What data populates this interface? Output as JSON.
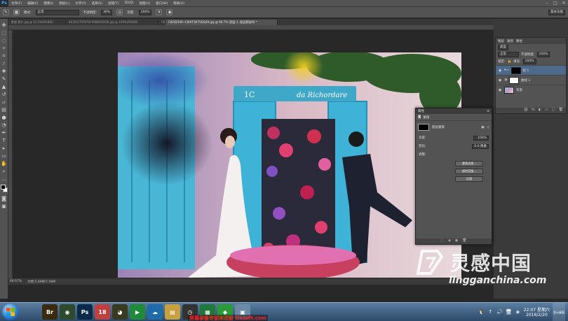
{
  "app": {
    "logo": "Ps"
  },
  "menus": [
    "文件(F)",
    "编辑(E)",
    "图像(I)",
    "图层(L)",
    "文字(Y)",
    "选择(S)",
    "滤镜(T)",
    "3D(D)",
    "视图(V)",
    "窗口(W)",
    "帮助(H)"
  ],
  "window_buttons": [
    "–",
    "□",
    "✕"
  ],
  "options": {
    "mode_label": "模式:",
    "mode_value": "正常",
    "opacity_label": "不透明度:",
    "opacity_value": "30%",
    "flow_label": "流量:",
    "flow_value": "100%",
    "workspace": "基本功能"
  },
  "tabs": [
    {
      "label": "影楼-照片.jpg @ 12.5%(RGB/8)",
      "active": false
    },
    {
      "label": "4E3D17F0F0F0F59BB4ADQR.jpg @ 100%(RGB/8)",
      "active": false
    },
    {
      "label": "C8ZQ2HW...@ 100%(RGB/8)",
      "active": false
    },
    {
      "label": "C82QZHI4~C0HIT.947SQQ49.jpg @ 66.7% (图层 1, 图层蒙版/8) *",
      "active": true
    }
  ],
  "status": {
    "zoom": "66.67%",
    "doc": "文档:5.69M/7.59M"
  },
  "layers": {
    "tabs": [
      "图层",
      "通道",
      "路径"
    ],
    "kind_label": "类型",
    "blend": "正常",
    "opacity_label": "不透明度:",
    "opacity_value": "100%",
    "lock_label": "锁定:",
    "fill_label": "填充:",
    "fill_value": "100%",
    "items": [
      {
        "name": "组 1",
        "thumb": "black",
        "selected": true
      },
      {
        "name": "曲线 1",
        "thumb": "white",
        "selected": false
      },
      {
        "name": "背景",
        "thumb": "photo",
        "selected": false
      }
    ],
    "footer_icons": [
      "⛓",
      "fx",
      "◐",
      "▭",
      "▢",
      "🗑"
    ]
  },
  "properties": {
    "header": "属性",
    "title": "蒙版",
    "mask_label": "图层蒙版",
    "density_label": "浓度:",
    "density_value": "100%",
    "feather_label": "羽化:",
    "feather_value": "0.0 像素",
    "adjust_label": "调整:",
    "btn_edge": "蒙版边缘...",
    "btn_color": "颜色范围...",
    "btn_invert": "反相"
  },
  "watermark": {
    "cn": "灵感中国",
    "url": "lingganchina.com"
  },
  "taskbar": {
    "apps": [
      {
        "name": "bridge-app",
        "label": "Br",
        "color": "#3a2a10"
      },
      {
        "name": "eye-app",
        "label": "◉",
        "color": "#2d4a2d"
      },
      {
        "name": "photoshop-app",
        "label": "Ps",
        "color": "#0a2a4a"
      },
      {
        "name": "calendar-app",
        "label": "18",
        "color": "#c04040"
      },
      {
        "name": "qq-app",
        "label": "◕",
        "color": "#3a3a20"
      },
      {
        "name": "media-app",
        "label": "▶",
        "color": "#1f8a3a"
      },
      {
        "name": "cloud-app",
        "label": "☁",
        "color": "#1f6aa8"
      },
      {
        "name": "folder-app",
        "label": "▤",
        "color": "#c8a040"
      },
      {
        "name": "clock-app",
        "label": "◷",
        "color": "#333"
      },
      {
        "name": "excel-app",
        "label": "▦",
        "color": "#1f7a3a"
      },
      {
        "name": "green-app",
        "label": "◆",
        "color": "#2a9a3a"
      },
      {
        "name": "window-app",
        "label": "▣",
        "color": "#6a8aa8"
      }
    ],
    "time": "22:07 星期六",
    "date": "2016/2/20",
    "tray_icons": [
      "🐧",
      "↑",
      "🔊",
      "🖥",
      "◈"
    ],
    "show_desktop": "显示桌面"
  },
  "caption": "屏幕录像专家未注册 tlxsoft.com"
}
